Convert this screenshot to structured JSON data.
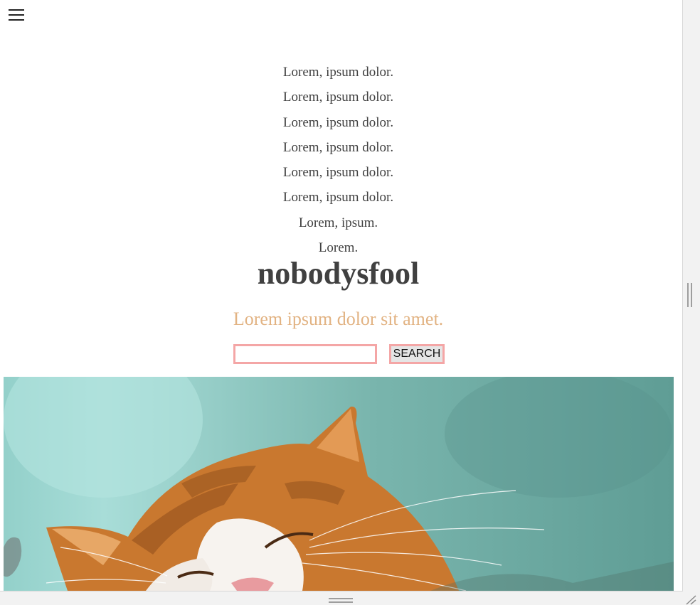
{
  "nav": {
    "menu_icon": "hamburger-menu-icon",
    "items": [
      {
        "label": "Lorem, ipsum dolor."
      },
      {
        "label": "Lorem, ipsum dolor."
      },
      {
        "label": "Lorem, ipsum dolor."
      },
      {
        "label": "Lorem, ipsum dolor."
      },
      {
        "label": "Lorem, ipsum dolor."
      },
      {
        "label": "Lorem, ipsum dolor."
      },
      {
        "label": "Lorem, ipsum."
      },
      {
        "label": "Lorem."
      }
    ]
  },
  "brand": {
    "title": "nobodysfool"
  },
  "tagline": {
    "text": "Lorem ipsum dolor sit amet."
  },
  "search": {
    "value": "",
    "button_label": "SEARCH"
  },
  "colors": {
    "text": "#404040",
    "tagline": "#e2b383",
    "search_border": "#f4a6a6",
    "button_bg": "#e5e5e5"
  },
  "hero": {
    "image": "sleeping-orange-cat-photo"
  }
}
